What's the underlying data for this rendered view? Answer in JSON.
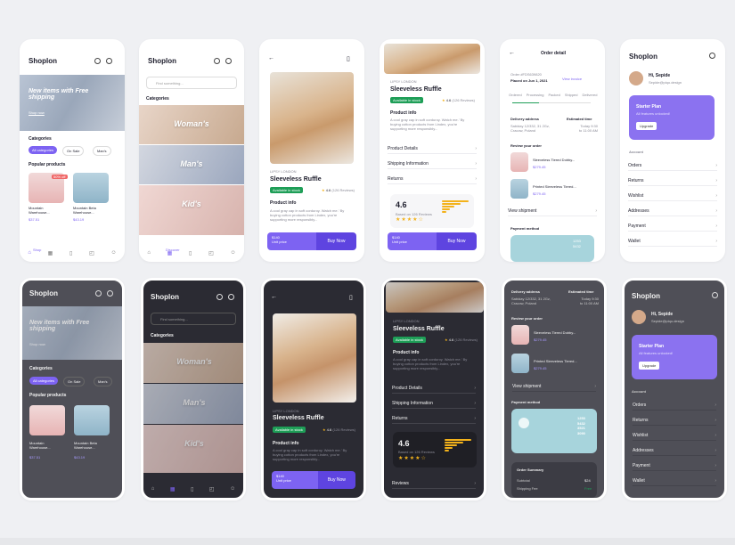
{
  "brand": "Shoplon",
  "home": {
    "hero": "New items with Free shipping",
    "shop_now": "Shop now",
    "categories_title": "Categories",
    "chips": [
      "All categories",
      "On Sale",
      "Man's"
    ],
    "popular_title": "Popular products",
    "products": [
      {
        "name": "Mountain Warehouse...",
        "price": "$37.51",
        "old": "$81.14",
        "badge": "50% off"
      },
      {
        "name": "Mountain Beta Warehouse...",
        "price": "$43.19",
        "old": "$52.00",
        "badge": ""
      }
    ],
    "tab_shop": "Shop"
  },
  "discover": {
    "search_placeholder": "Find something...",
    "categories_title": "Categories",
    "cats": [
      "Woman's",
      "Man's",
      "Kid's"
    ],
    "tab_discover": "Discover"
  },
  "product": {
    "store": "LIPSY LONDON",
    "title": "Sleeveless Ruffle",
    "badge": "Available in stock",
    "rating": "4.6",
    "reviews": "(126 Reviews)",
    "info_title": "Product info",
    "info_text": "A cool gray cap in soft corduroy. Watch me.' By buying cotton products from Lindex, you're supporting more responsibly...",
    "price": "$140",
    "price_note": "Unit price",
    "buy_now": "Buy Now",
    "rows": [
      "Product Details",
      "Shipping Information",
      "Returns"
    ],
    "big_rating": "4.6",
    "rating_of": "/5",
    "based_on": "Based on 126 Reviews",
    "star_labels": [
      "5 Star",
      "4 Star",
      "3 Star",
      "2 Star",
      "1 Star"
    ],
    "reviews_row": "Reviews"
  },
  "order": {
    "title": "Order detail",
    "order_label": "Order #FDS639820",
    "placed_on": "Placed on Jun 1, 2021",
    "view_invoice": "View invoice",
    "steps": [
      "Ordered",
      "Processing",
      "Packed",
      "Shipped",
      "Delivered"
    ],
    "delivery_address": "Delivery address",
    "address": "Sabiday 12/332, 31 2Gz, Cracow, Poland",
    "estimated_time": "Estimated time",
    "est_value": "Today 9:30 to 11:00 AM",
    "review_order": "Review your order",
    "items": [
      {
        "name": "Sleeveless Tiered Dobby...",
        "price": "$279.45",
        "old": "$280.83"
      },
      {
        "name": "Printed Sleeveless Tiered...",
        "price": "$279.45",
        "old": "$280.83"
      }
    ],
    "view_shipment": "View shipment",
    "payment_method": "Payment method",
    "card_numbers": [
      "1253",
      "5432",
      "3521",
      "3090"
    ],
    "summary_title": "Order Summary",
    "subtotal_label": "Subtotal",
    "subtotal": "$24",
    "shipping_label": "Shipping Fee",
    "shipping": "Free"
  },
  "profile": {
    "greeting": "Hi, Sepide",
    "email": "Sepide@piqo.design",
    "plan": "Starter Plan",
    "plan_note": "All features unlocked!",
    "upgrade": "Upgrade",
    "account_title": "Account",
    "items": [
      "Orders",
      "Returns",
      "Wishlist",
      "Addresses",
      "Payment",
      "Wallet"
    ]
  },
  "colors": {
    "accent": "#7d63f2",
    "dark": "#2b2b33",
    "gray": "#4f4f57",
    "card_teal": "#a7d4dc"
  }
}
